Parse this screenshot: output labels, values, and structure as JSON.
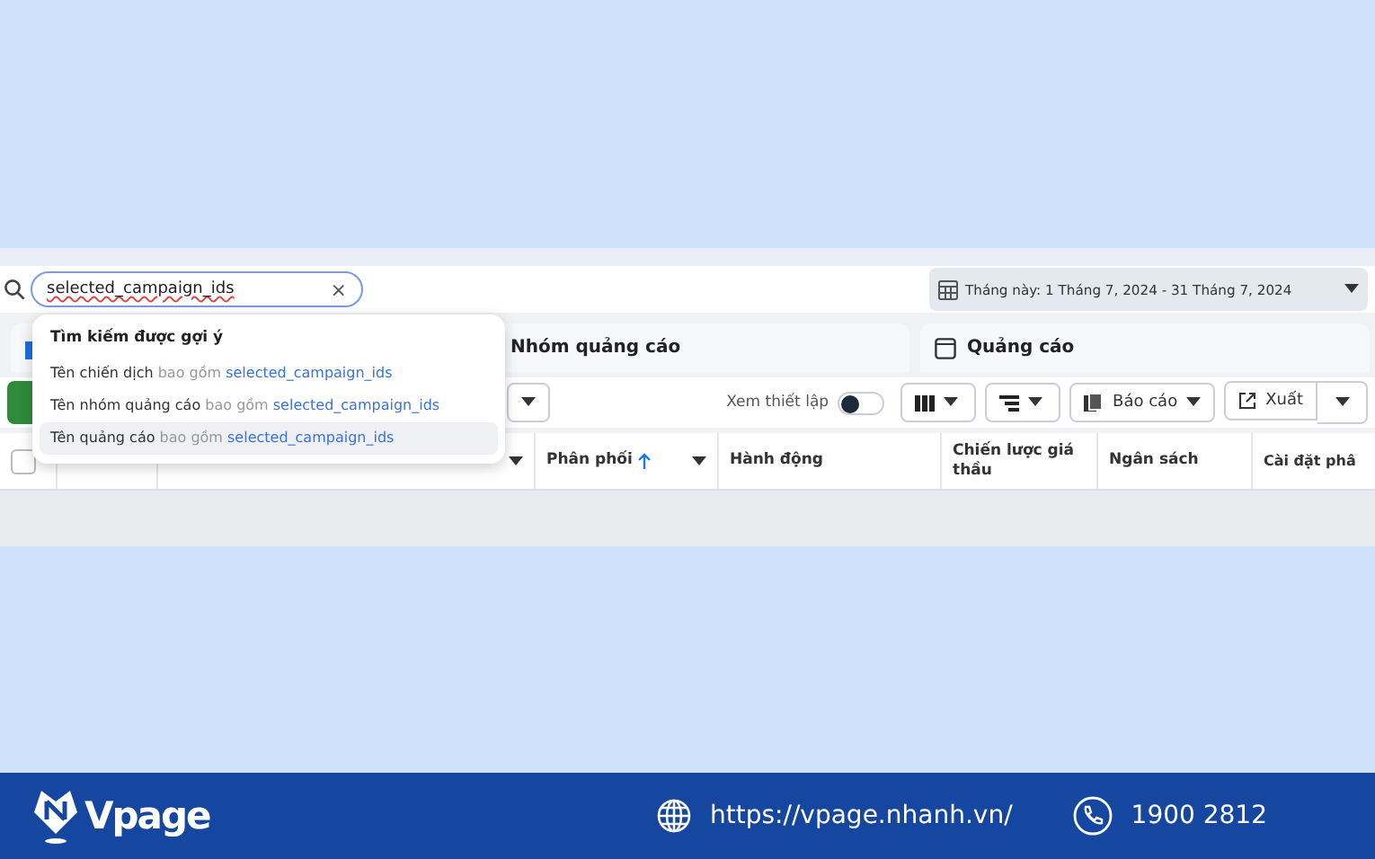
{
  "search": {
    "value": "selected_campaign_ids",
    "clear": "×"
  },
  "date_range": {
    "label": "Tháng này: 1 Tháng 7, 2024 - 31 Tháng 7, 2024"
  },
  "tabs": [
    {
      "label": "Nhóm quảng cáo"
    },
    {
      "label": "Quảng cáo"
    }
  ],
  "toolbar": {
    "view_setup": {
      "label": "Xem thiết lập",
      "on": false
    },
    "report": "Báo cáo",
    "export": "Xuất"
  },
  "select_all": {
    "checked": false
  },
  "columns": [
    {
      "label": "Phân phối",
      "sorted_ascending": true
    },
    {
      "label": "Hành động",
      "sorted_ascending": false
    },
    {
      "label": "Chiến lược giá thầu",
      "sorted_ascending": false
    },
    {
      "label": "Ngân sách",
      "sorted_ascending": false
    },
    {
      "label": "Cài đặt phâ",
      "sorted_ascending": false
    }
  ],
  "suggestions": {
    "title": "Tìm kiếm được gợi ý",
    "items": [
      {
        "field": "Tên chiến dịch",
        "op": "bao gồm",
        "value": "selected_campaign_ids",
        "selected": false
      },
      {
        "field": "Tên nhóm quảng cáo",
        "op": "bao gồm",
        "value": "selected_campaign_ids",
        "selected": false
      },
      {
        "field": "Tên quảng cáo",
        "op": "bao gồm",
        "value": "selected_campaign_ids",
        "selected": true
      }
    ]
  },
  "footer": {
    "brand": "Vpage",
    "url": "https://vpage.nhanh.vn/",
    "phone": "1900 2812"
  }
}
